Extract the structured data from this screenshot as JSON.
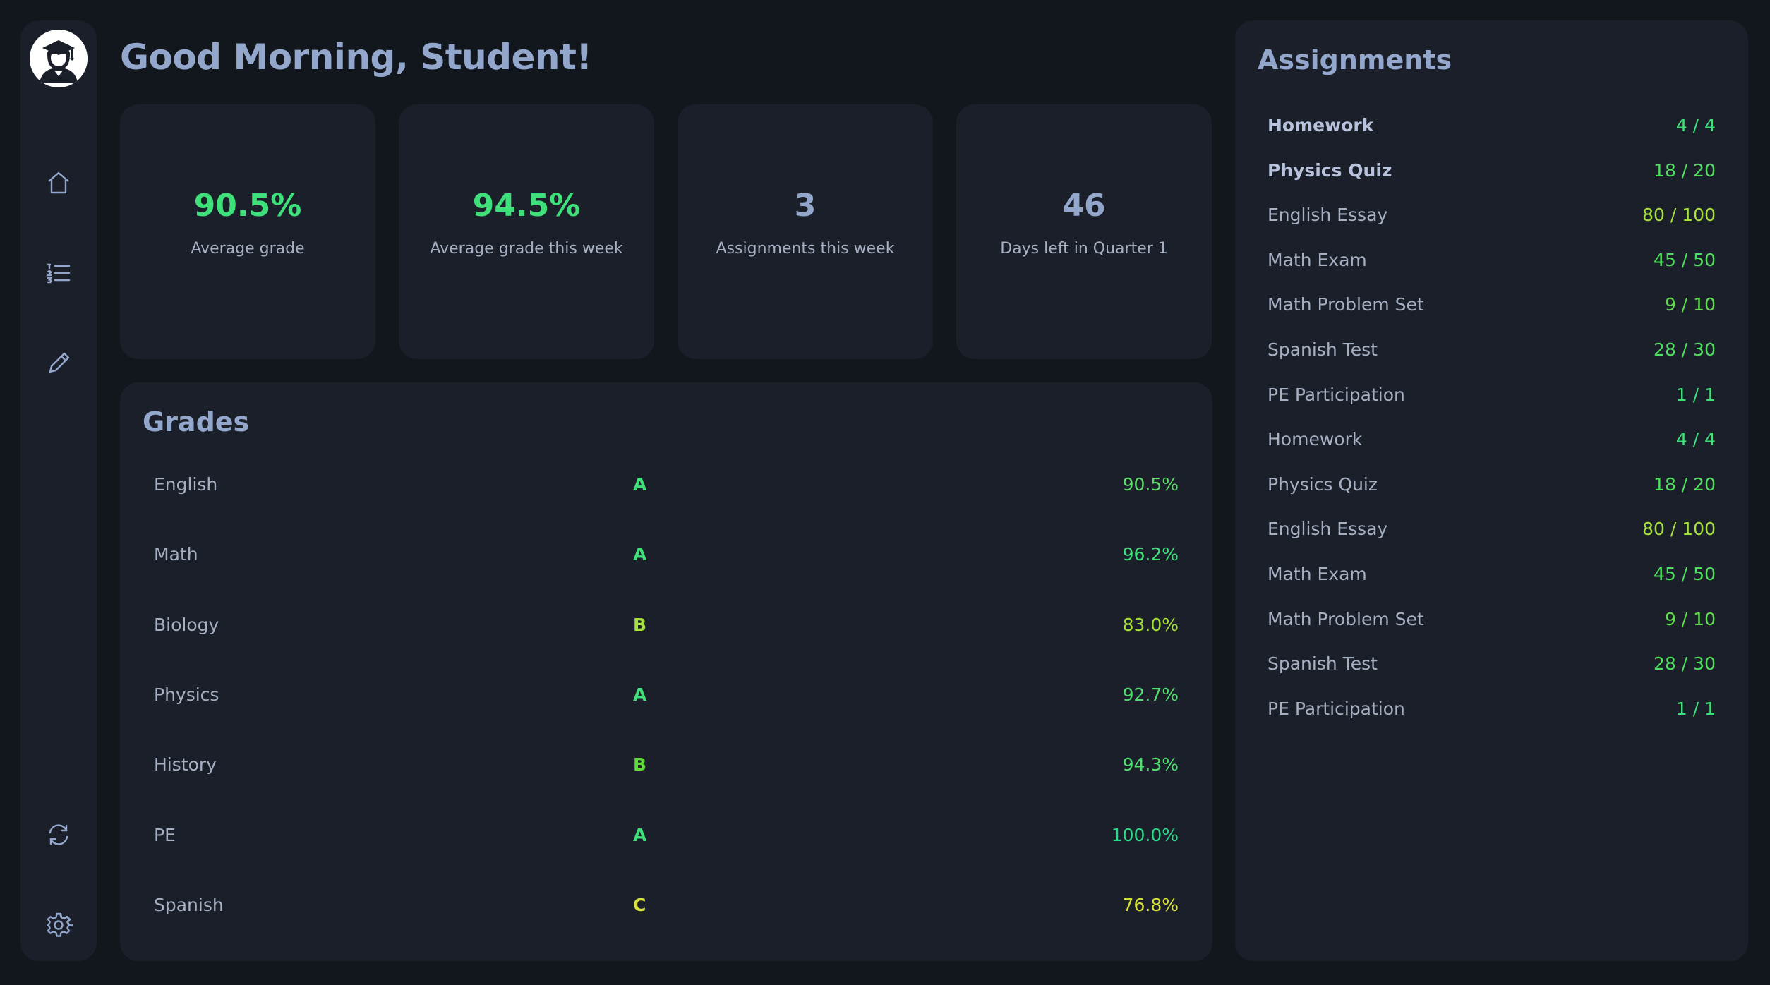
{
  "greeting": "Good Morning, Student!",
  "sidebar": {
    "avatar": "graduate-avatar",
    "nav_items": [
      {
        "icon": "home-icon"
      },
      {
        "icon": "list-icon"
      },
      {
        "icon": "pencil-icon"
      }
    ],
    "bottom_items": [
      {
        "icon": "refresh-icon"
      },
      {
        "icon": "gear-icon"
      }
    ]
  },
  "stats": [
    {
      "value": "90.5%",
      "label": "Average grade",
      "color": "#3ee07a"
    },
    {
      "value": "94.5%",
      "label": "Average grade this week",
      "color": "#3ee07a"
    },
    {
      "value": "3",
      "label": "Assignments this week",
      "color": "#93a6cc"
    },
    {
      "value": "46",
      "label": "Days left in Quarter 1",
      "color": "#93a6cc"
    }
  ],
  "grades": {
    "title": "Grades",
    "rows": [
      {
        "subject": "English",
        "letter": "A",
        "percent": "90.5%",
        "letter_color": "#3ee07a",
        "percent_color": "#5fdc6a"
      },
      {
        "subject": "Math",
        "letter": "A",
        "percent": "96.2%",
        "letter_color": "#3ee07a",
        "percent_color": "#3ee07a"
      },
      {
        "subject": "Biology",
        "letter": "B",
        "percent": "83.0%",
        "letter_color": "#a6e03a",
        "percent_color": "#a6e03a"
      },
      {
        "subject": "Physics",
        "letter": "A",
        "percent": "92.7%",
        "letter_color": "#3ee07a",
        "percent_color": "#4fdf6e"
      },
      {
        "subject": "History",
        "letter": "B",
        "percent": "94.3%",
        "letter_color": "#5fdc3a",
        "percent_color": "#4fdf6e"
      },
      {
        "subject": "PE",
        "letter": "A",
        "percent": "100.0%",
        "letter_color": "#3ee07a",
        "percent_color": "#2fd98c"
      },
      {
        "subject": "Spanish",
        "letter": "C",
        "percent": "76.8%",
        "letter_color": "#d8e03a",
        "percent_color": "#d8e03a"
      }
    ]
  },
  "assignments": {
    "title": "Assignments",
    "rows": [
      {
        "name": "Homework",
        "score": "4 / 4",
        "bold": true,
        "color": "#3ee07a"
      },
      {
        "name": "Physics Quiz",
        "score": "18 / 20",
        "bold": true,
        "color": "#4fdf5e"
      },
      {
        "name": "English Essay",
        "score": "80 / 100",
        "bold": false,
        "color": "#a6e03a"
      },
      {
        "name": "Math Exam",
        "score": "45 / 50",
        "bold": false,
        "color": "#4fdf5e"
      },
      {
        "name": "Math Problem Set",
        "score": "9 / 10",
        "bold": false,
        "color": "#5fdc4a"
      },
      {
        "name": "Spanish Test",
        "score": "28 / 30",
        "bold": false,
        "color": "#4fdf5e"
      },
      {
        "name": "PE Participation",
        "score": "1 / 1",
        "bold": false,
        "color": "#3ee07a"
      },
      {
        "name": "Homework",
        "score": "4 / 4",
        "bold": false,
        "color": "#3ee07a"
      },
      {
        "name": "Physics Quiz",
        "score": "18 / 20",
        "bold": false,
        "color": "#4fdf5e"
      },
      {
        "name": "English Essay",
        "score": "80 / 100",
        "bold": false,
        "color": "#a6e03a"
      },
      {
        "name": "Math Exam",
        "score": "45 / 50",
        "bold": false,
        "color": "#4fdf5e"
      },
      {
        "name": "Math Problem Set",
        "score": "9 / 10",
        "bold": false,
        "color": "#5fdc4a"
      },
      {
        "name": "Spanish Test",
        "score": "28 / 30",
        "bold": false,
        "color": "#4fdf5e"
      },
      {
        "name": "PE Participation",
        "score": "1 / 1",
        "bold": false,
        "color": "#3ee07a"
      }
    ]
  }
}
